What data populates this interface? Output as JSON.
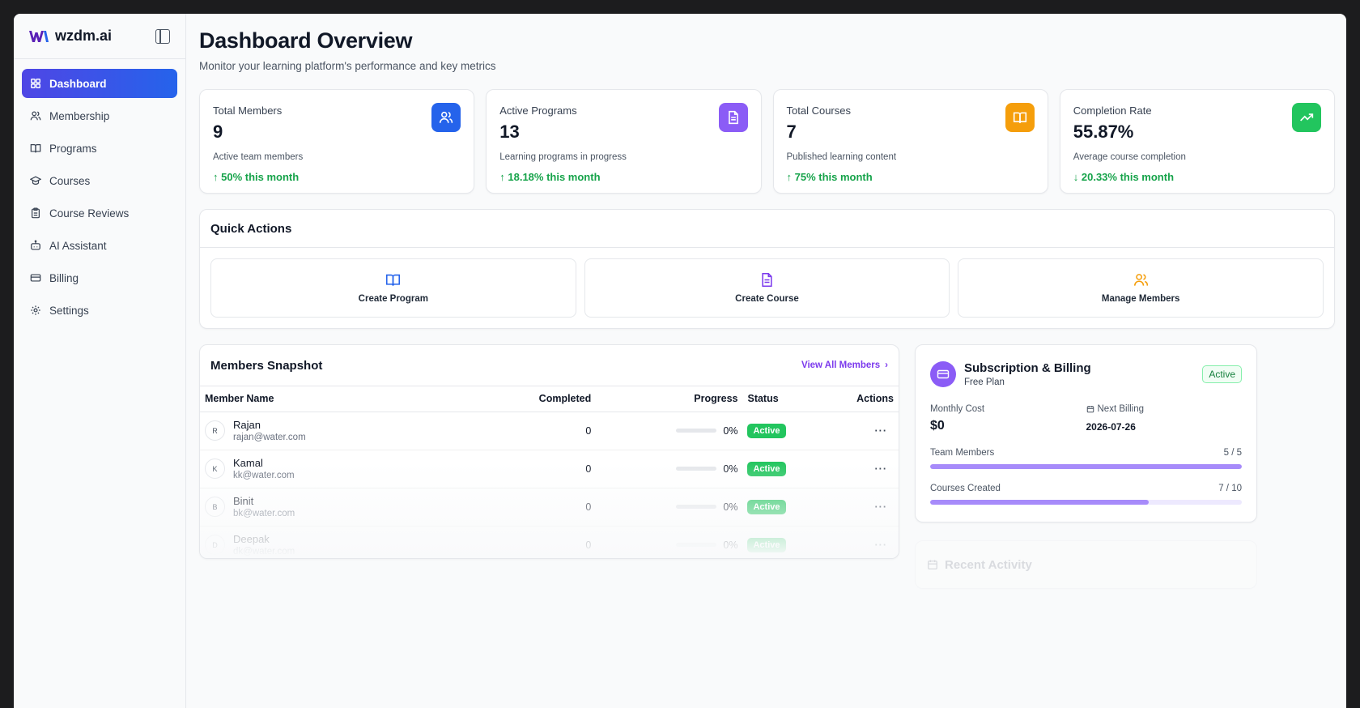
{
  "brand": {
    "name": "wzdm.ai",
    "logo_color": "#5b21b6"
  },
  "sidebar": {
    "items": [
      {
        "label": "Dashboard",
        "icon": "grid-icon",
        "active": true
      },
      {
        "label": "Membership",
        "icon": "users-icon"
      },
      {
        "label": "Programs",
        "icon": "book-icon"
      },
      {
        "label": "Courses",
        "icon": "graduation-cap-icon"
      },
      {
        "label": "Course Reviews",
        "icon": "clipboard-icon"
      },
      {
        "label": "AI Assistant",
        "icon": "bot-icon"
      },
      {
        "label": "Billing",
        "icon": "credit-card-icon"
      },
      {
        "label": "Settings",
        "icon": "gear-icon"
      }
    ]
  },
  "header": {
    "title": "Dashboard Overview",
    "subtitle": "Monitor your learning platform's performance and key metrics"
  },
  "stats": [
    {
      "label": "Total Members",
      "value": "9",
      "desc": "Active team members",
      "change": "50% this month",
      "trend": "up",
      "icon": "users-icon",
      "color": "#2563eb"
    },
    {
      "label": "Active Programs",
      "value": "13",
      "desc": "Learning programs in progress",
      "change": "18.18% this month",
      "trend": "up",
      "icon": "document-icon",
      "color": "#8b5cf6"
    },
    {
      "label": "Total Courses",
      "value": "7",
      "desc": "Published learning content",
      "change": "75% this month",
      "trend": "up",
      "icon": "book-open-icon",
      "color": "#f59e0b"
    },
    {
      "label": "Completion Rate",
      "value": "55.87%",
      "desc": "Average course completion",
      "change": "20.33% this month",
      "trend": "down",
      "icon": "trending-up-icon",
      "color": "#22c55e"
    }
  ],
  "quick_actions": {
    "title": "Quick Actions",
    "items": [
      {
        "label": "Create Program",
        "icon": "book-open-icon",
        "color": "#2563eb"
      },
      {
        "label": "Create Course",
        "icon": "document-icon",
        "color": "#7c3aed"
      },
      {
        "label": "Manage Members",
        "icon": "users-icon",
        "color": "#f59e0b"
      }
    ]
  },
  "members": {
    "title": "Members Snapshot",
    "view_all": "View All Members",
    "columns": [
      "Member Name",
      "Completed",
      "Progress",
      "Status",
      "Actions"
    ],
    "rows": [
      {
        "initial": "R",
        "name": "Rajan",
        "email": "rajan@water.com",
        "completed": "0",
        "progress": "0%",
        "status": "Active",
        "actions": "···"
      },
      {
        "initial": "K",
        "name": "Kamal",
        "email": "kk@water.com",
        "completed": "0",
        "progress": "0%",
        "status": "Active",
        "actions": "···"
      },
      {
        "initial": "B",
        "name": "Binit",
        "email": "bk@water.com",
        "completed": "0",
        "progress": "0%",
        "status": "Active",
        "actions": "···"
      },
      {
        "initial": "D",
        "name": "Deepak",
        "email": "dk@water.com",
        "completed": "0",
        "progress": "0%",
        "status": "Active",
        "actions": "···"
      }
    ]
  },
  "billing": {
    "title": "Subscription & Billing",
    "plan": "Free Plan",
    "badge": "Active",
    "monthly_cost_label": "Monthly Cost",
    "monthly_cost": "$0",
    "next_billing_label": "Next Billing",
    "next_billing": "2026-07-26",
    "team_members_label": "Team Members",
    "team_members": "5 / 5",
    "team_members_fraction": 1.0,
    "courses_created_label": "Courses Created",
    "courses_created": "7 / 10",
    "courses_created_fraction": 0.7
  },
  "recent_activity": {
    "title": "Recent Activity"
  }
}
